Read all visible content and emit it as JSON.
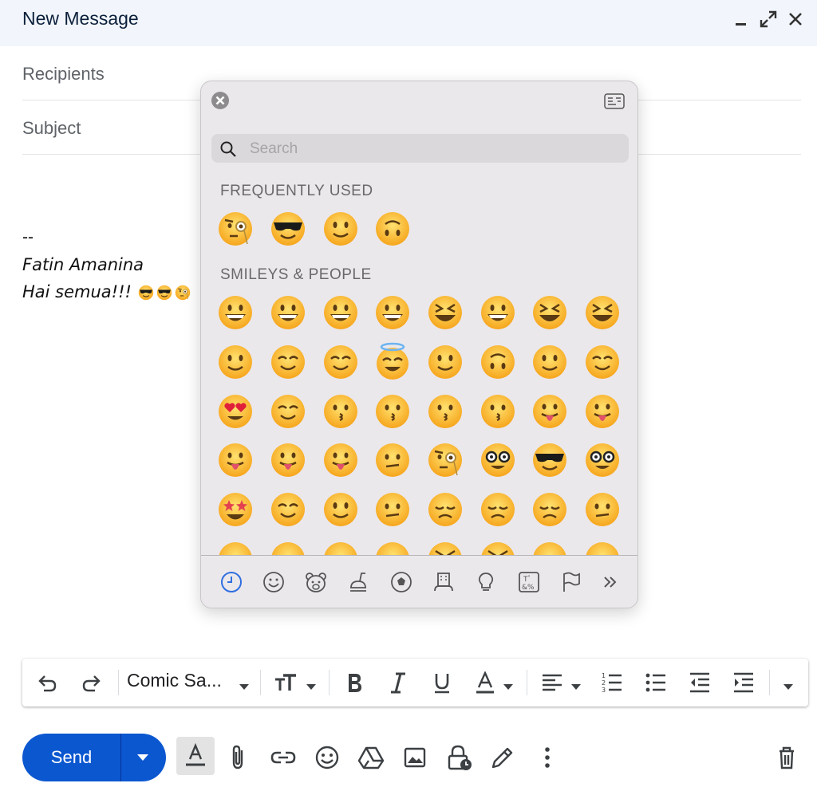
{
  "window": {
    "title": "New Message",
    "controls": [
      "minimize-icon",
      "expand-icon",
      "close-icon"
    ]
  },
  "fields": {
    "recipients_placeholder": "Recipients",
    "subject_placeholder": "Subject"
  },
  "body": {
    "separator": "--",
    "name": "Fatin Amanina",
    "greeting": "Hai semua!!!",
    "greeting_emojis": [
      "sunglasses",
      "sunglasses",
      "monocle"
    ]
  },
  "emoji_picker": {
    "search_placeholder": "Search",
    "sections": [
      {
        "label": "FREQUENTLY USED",
        "emojis": [
          "face-with-monocle",
          "smiling-face-with-sunglasses",
          "slightly-smiling-face",
          "upside-down-face"
        ]
      },
      {
        "label": "SMILEYS & PEOPLE",
        "rows": [
          [
            "grinning",
            "grinning-big-eyes",
            "grinning-smiling-eyes",
            "beaming",
            "squinting",
            "sweat-smile",
            "tears-of-joy",
            "rolling-on-floor"
          ],
          [
            "smiling-with-tear",
            "relaxed",
            "smiling-eyes",
            "halo",
            "slightly-smiling",
            "upside-down",
            "winking",
            "relieved"
          ],
          [
            "heart-eyes",
            "smiling-with-hearts",
            "blowing-kiss",
            "kissing",
            "kissing-smiling-eyes",
            "kissing-closed-eyes",
            "savoring-food",
            "tongue-out"
          ],
          [
            "squinting-tongue",
            "winking-tongue",
            "zany",
            "raised-eyebrow",
            "monocle",
            "nerd",
            "sunglasses",
            "disguised"
          ],
          [
            "star-struck",
            "partying",
            "smirking",
            "unamused",
            "disappointed",
            "pensive",
            "worried",
            "confused"
          ],
          [
            "persevering",
            "confounded",
            "tired",
            "weary",
            "pleading",
            "crying",
            "loudly-crying",
            "steam"
          ]
        ]
      }
    ],
    "categories": [
      "clock-icon",
      "smiley-icon",
      "bear-icon",
      "food-icon",
      "ball-icon",
      "building-icon",
      "bulb-icon",
      "symbols-icon",
      "flag-icon",
      "more-icon"
    ],
    "active_category": "clock-icon"
  },
  "toolbar": {
    "font": "Comic Sa...",
    "items": [
      "undo-icon",
      "redo-icon",
      "font-size-icon",
      "bold-icon",
      "italic-icon",
      "underline-icon",
      "text-color-icon",
      "align-icon",
      "numbered-list-icon",
      "bulleted-list-icon",
      "indent-less-icon",
      "indent-more-icon",
      "more-formatting-icon"
    ]
  },
  "bottom": {
    "send_label": "Send",
    "send_color": "#0b57d0",
    "items": [
      "formatting-toggle-icon",
      "attach-icon",
      "link-icon",
      "emoji-icon",
      "drive-icon",
      "photo-icon",
      "confidential-icon",
      "signature-icon",
      "more-options-icon",
      "discard-icon"
    ]
  }
}
